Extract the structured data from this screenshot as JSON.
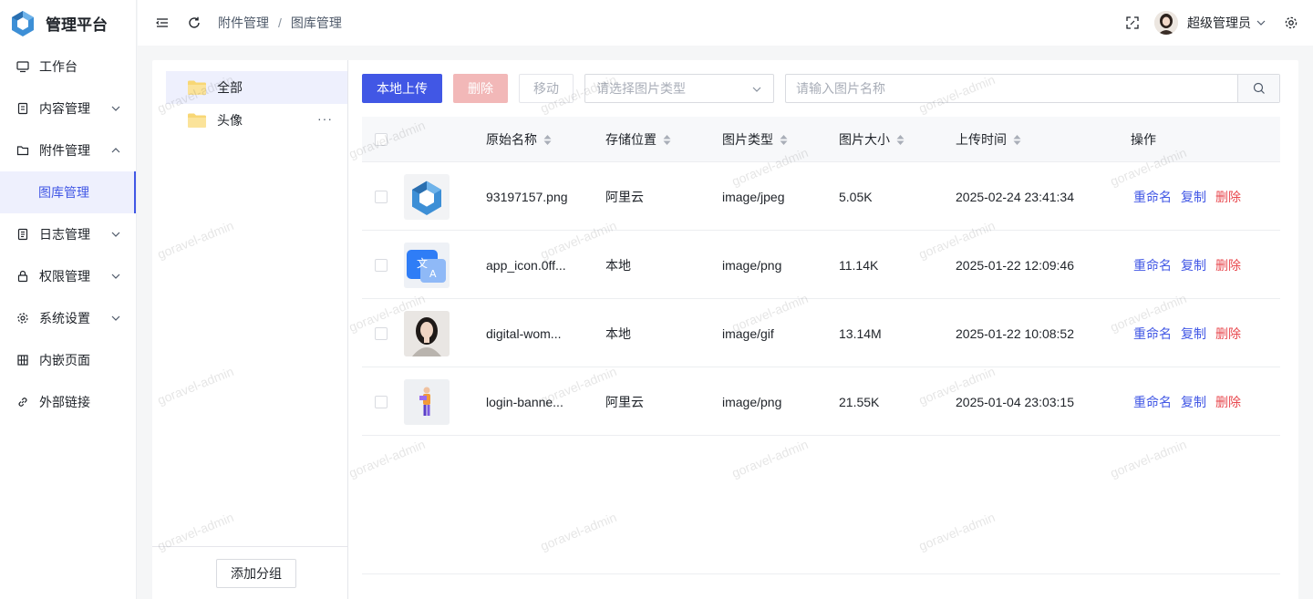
{
  "app": {
    "title": "管理平台",
    "logo": "cube-logo"
  },
  "sidebar": {
    "items": [
      {
        "label": "工作台",
        "icon": "monitor-icon"
      },
      {
        "label": "内容管理",
        "icon": "document-icon",
        "arrow": "chevron-down"
      },
      {
        "label": "附件管理",
        "icon": "folder-icon",
        "arrow": "chevron-up"
      },
      {
        "label": "图库管理",
        "sub": true,
        "active": true
      },
      {
        "label": "日志管理",
        "icon": "log-icon",
        "arrow": "chevron-down"
      },
      {
        "label": "权限管理",
        "icon": "lock-icon",
        "arrow": "chevron-down"
      },
      {
        "label": "系统设置",
        "icon": "gear-icon",
        "arrow": "chevron-down"
      },
      {
        "label": "内嵌页面",
        "icon": "grid-icon"
      },
      {
        "label": "外部链接",
        "icon": "link-icon"
      }
    ]
  },
  "header": {
    "breadcrumb": [
      "附件管理",
      "图库管理"
    ],
    "separator": "/",
    "username": "超级管理员"
  },
  "groups": {
    "items": [
      {
        "label": "全部",
        "active": true
      },
      {
        "label": "头像",
        "more": "···"
      }
    ],
    "add_button": "添加分组"
  },
  "toolbar": {
    "upload_label": "本地上传",
    "delete_label": "删除",
    "move_label": "移动",
    "type_select_placeholder": "请选择图片类型",
    "search_placeholder": "请输入图片名称"
  },
  "table": {
    "columns": [
      "原始名称",
      "存储位置",
      "图片类型",
      "图片大小",
      "上传时间",
      "操作"
    ],
    "rows": [
      {
        "name": "93197157.png",
        "storage": "阿里云",
        "type": "image/jpeg",
        "size": "5.05K",
        "time": "2025-02-24 23:41:34",
        "thumb": "cube-logo"
      },
      {
        "name": "app_icon.0ff...",
        "storage": "本地",
        "type": "image/png",
        "size": "11.14K",
        "time": "2025-01-22 12:09:46",
        "thumb": "translate-app-icon"
      },
      {
        "name": "digital-wom...",
        "storage": "本地",
        "type": "image/gif",
        "size": "13.14M",
        "time": "2025-01-22 10:08:52",
        "thumb": "woman-portrait"
      },
      {
        "name": "login-banne...",
        "storage": "阿里云",
        "type": "image/png",
        "size": "21.55K",
        "time": "2025-01-04 23:03:15",
        "thumb": "person-illustration"
      }
    ],
    "actions": {
      "rename": "重命名",
      "copy": "复制",
      "delete": "删除"
    }
  },
  "watermark": "goravel-admin",
  "colors": {
    "primary": "#4157e5",
    "danger": "#e8484e",
    "danger_disabled": "#f2b8b8",
    "active_bg": "#eef0fd"
  }
}
